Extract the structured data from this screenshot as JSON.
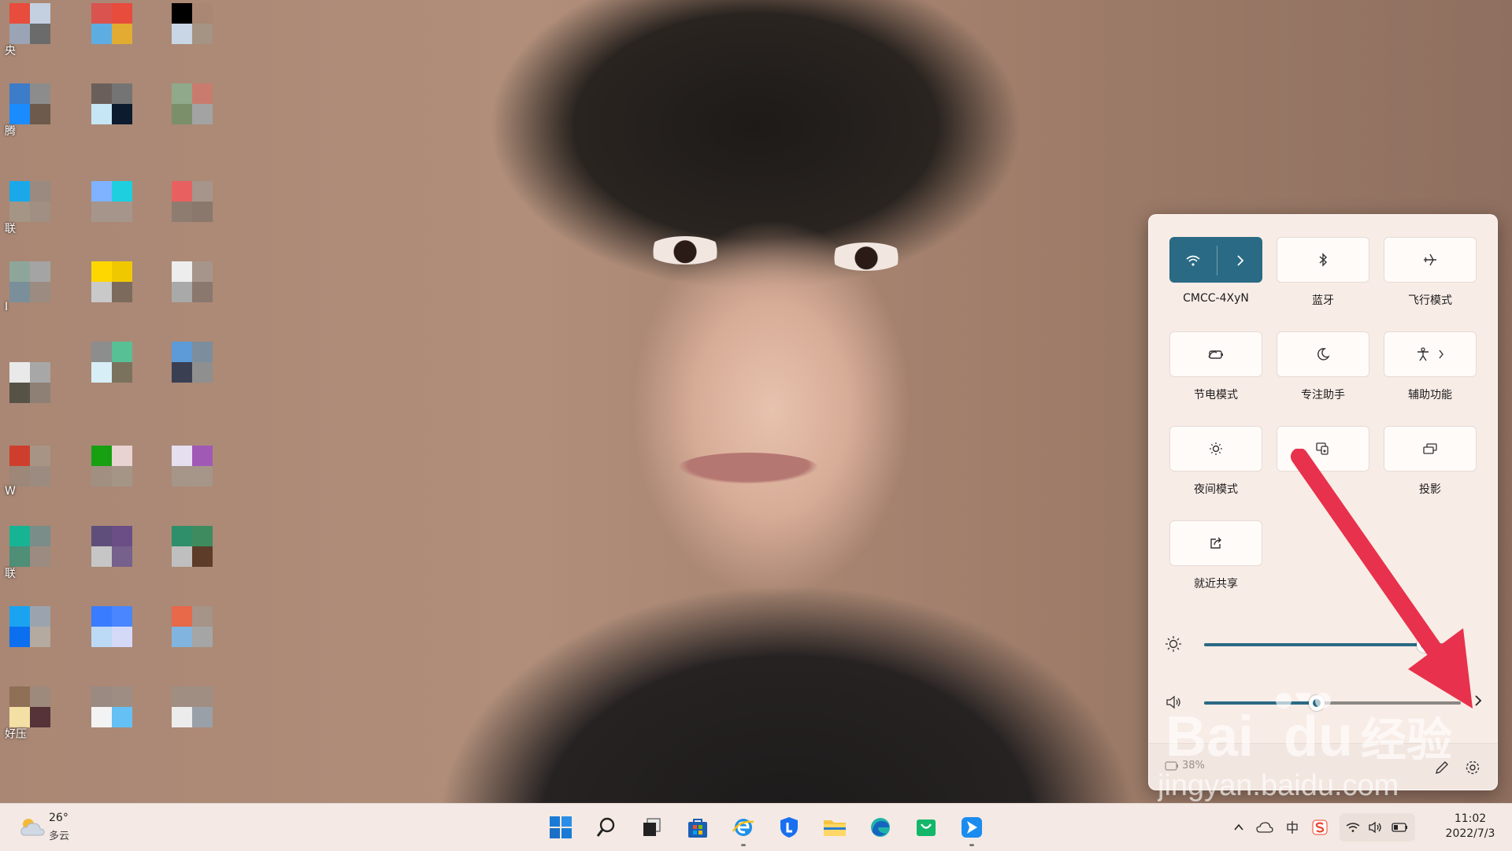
{
  "desktop": {
    "icon_labels": [
      "央",
      "腾",
      "联",
      "I",
      "W",
      "联",
      "好压"
    ]
  },
  "quick_settings": {
    "tiles": [
      {
        "id": "wifi",
        "label": "CMCC-4XyN",
        "icon": "wifi-icon",
        "active": true
      },
      {
        "id": "bluetooth",
        "label": "蓝牙",
        "icon": "bluetooth-icon",
        "active": false
      },
      {
        "id": "airplane",
        "label": "飞行模式",
        "icon": "airplane-icon",
        "active": false
      },
      {
        "id": "battery-saver",
        "label": "节电模式",
        "icon": "battery-saver-icon",
        "active": false
      },
      {
        "id": "focus",
        "label": "专注助手",
        "icon": "moon-icon",
        "active": false
      },
      {
        "id": "accessibility",
        "label": "辅助功能",
        "icon": "accessibility-icon",
        "active": false
      },
      {
        "id": "night-light",
        "label": "夜间模式",
        "icon": "sun-icon",
        "active": false
      },
      {
        "id": "mobile-hotspot",
        "label": "",
        "icon": "hotspot-icon",
        "active": false
      },
      {
        "id": "project",
        "label": "投影",
        "icon": "project-icon",
        "active": false
      },
      {
        "id": "nearby-share",
        "label": "就近共享",
        "icon": "share-icon",
        "active": false
      }
    ],
    "brightness": 0.86,
    "volume": 0.44,
    "battery_text": "38%"
  },
  "watermark": {
    "brand": "Bai",
    "brand2": "du",
    "cn": "经验",
    "url": "jingyan.baidu.com"
  },
  "taskbar": {
    "weather_temp": "26°",
    "weather_desc": "多云",
    "time": "11:02",
    "date": "2022/7/3"
  },
  "colors": {
    "accent": "#2a6a84",
    "arrow": "#e8314c",
    "panel_bg": "#f8ece6"
  }
}
